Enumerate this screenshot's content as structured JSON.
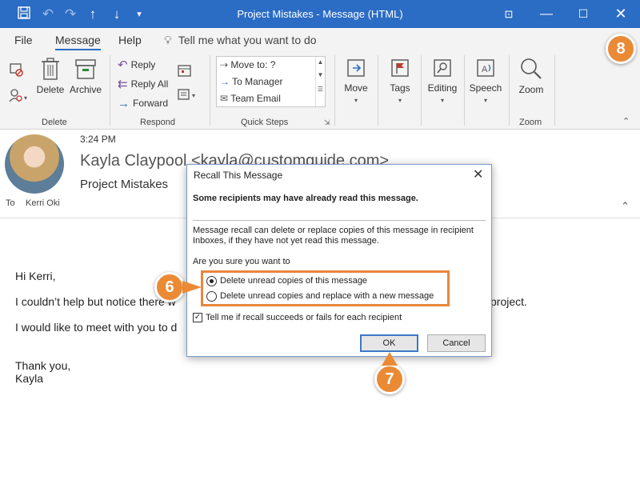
{
  "titlebar": {
    "title": "Project Mistakes  -  Message (HTML)",
    "icons": [
      "save-icon",
      "undo-icon",
      "redo-icon",
      "up-arrow-icon",
      "down-arrow-icon",
      "customize-icon",
      "ribbon-display-icon",
      "minimize-icon",
      "maximize-icon",
      "close-icon"
    ]
  },
  "menu": {
    "tabs": [
      "File",
      "Message",
      "Help"
    ],
    "active_tab": "Message",
    "tell_me": "Tell me what you want to do"
  },
  "ribbon": {
    "delete_group": {
      "label": "Delete",
      "delete": "Delete",
      "archive": "Archive"
    },
    "respond_group": {
      "label": "Respond",
      "reply": "Reply",
      "reply_all": "Reply All",
      "forward": "Forward"
    },
    "quick_steps_group": {
      "label": "Quick Steps",
      "items": [
        "Move to: ?",
        "To Manager",
        "Team Email"
      ]
    },
    "move": "Move",
    "tags": "Tags",
    "editing": "Editing",
    "speech": "Speech",
    "zoom": "Zoom",
    "zoom_group_label": "Zoom"
  },
  "message": {
    "time": "3:24 PM",
    "from": "Kayla Claypool <kayla@customguide.com>",
    "subject": "Project Mistakes",
    "to_label": "To",
    "to_name": "Kerri Oki",
    "body": [
      "Hi Kerri,",
      "I couldn’t help but notice there w",
      "project.",
      "I would like to meet with you to d",
      "Thank you,",
      "Kayla"
    ]
  },
  "dialog": {
    "title": "Recall This Message",
    "warning": "Some recipients may have already read this message.",
    "desc_line1": "Message recall can delete or replace copies of this message in recipient",
    "desc_line2": "Inboxes, if they have not yet read this message.",
    "question": "Are you sure you want to",
    "option1": "Delete unread copies of this message",
    "option2": "Delete unread copies and replace with a new message",
    "selected_option": "option1",
    "checkbox_label": "Tell me if recall succeeds or fails for each recipient",
    "checkbox_checked": true,
    "ok": "OK",
    "cancel": "Cancel"
  },
  "callouts": {
    "step6": "6",
    "step7": "7",
    "step8": "8"
  },
  "colors": {
    "titlebar": "#2b6cc4",
    "callout": "#ea8a35"
  }
}
